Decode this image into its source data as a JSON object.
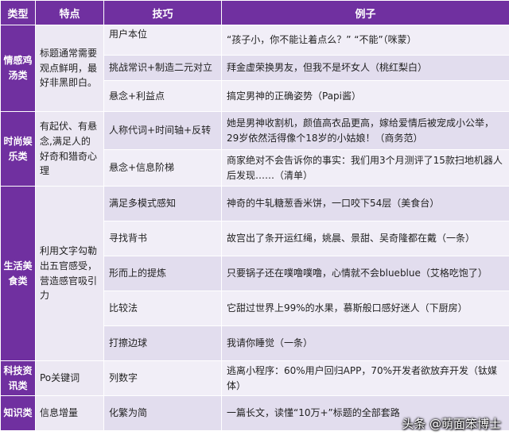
{
  "headers": [
    "类型",
    "特点",
    "技巧",
    "例子"
  ],
  "categories": [
    {
      "name": "情感鸡汤类",
      "feature": "标题通常需要观点鲜明，最好非黑即白。",
      "rows": [
        {
          "technique": "用户本位",
          "example": "“孩子小，你不能让着点么？” “不能”（咪蒙）"
        },
        {
          "technique": "挑战常识+制造二元对立",
          "example": "拜金虚荣换男友，但我不是坏女人（桃红梨白）"
        },
        {
          "technique": "悬念+利益点",
          "example": "搞定男神的正确姿势（Papi酱）"
        }
      ]
    },
    {
      "name": "时尚娱乐类",
      "feature": "有起伏、有悬念,满足人的好奇和猎奇心理",
      "rows": [
        {
          "technique": "人称代词+时间轴+反转",
          "example": "她是男神收割机，颜值高衣品更高，嫁给爱情后被宠成小公举，29岁依然活得像个18岁的小姑娘！（商务范）"
        },
        {
          "technique": "悬念+信息阶梯",
          "example": "商家绝对不会告诉你的事实：我们用3个月测评了15款扫地机器人后发现……（清单）"
        }
      ]
    },
    {
      "name": "生活美食类",
      "feature": "利用文字勾勒出五官感受，营造感官吸引力",
      "rows": [
        {
          "technique": "满足多模式感知",
          "example": "神奇的牛轧糖葱香米饼，一口咬下54层（美食台）"
        },
        {
          "technique": "寻找背书",
          "example": "故宫出了条开运红绳，姚晨、景甜、吴奇隆都在戴（一条）"
        },
        {
          "technique": "形而上的提炼",
          "example": "只要锅子还在噗噜噗噜，心情就不会blueblue（艾格吃饱了）"
        },
        {
          "technique": "比较法",
          "example": "它甜过世界上99%的水果，慕斯般口感好迷人（下厨房）"
        },
        {
          "technique": "打擦边球",
          "example": "我请你睡觉（一条）"
        }
      ]
    },
    {
      "name": "科技资讯类",
      "feature": "Po关键词",
      "rows": [
        {
          "technique": "列数字",
          "example": "逃离小程序：60%用户回归APP，70%开发者欲放弃开发（钛媒体）"
        }
      ]
    },
    {
      "name": "知识类",
      "feature": "信息增量",
      "rows": [
        {
          "technique": "化繁为简",
          "example": "一篇长文，读懂“10万+”标题的全部套路"
        }
      ]
    }
  ],
  "watermark": "头条 @萌面笨博士"
}
